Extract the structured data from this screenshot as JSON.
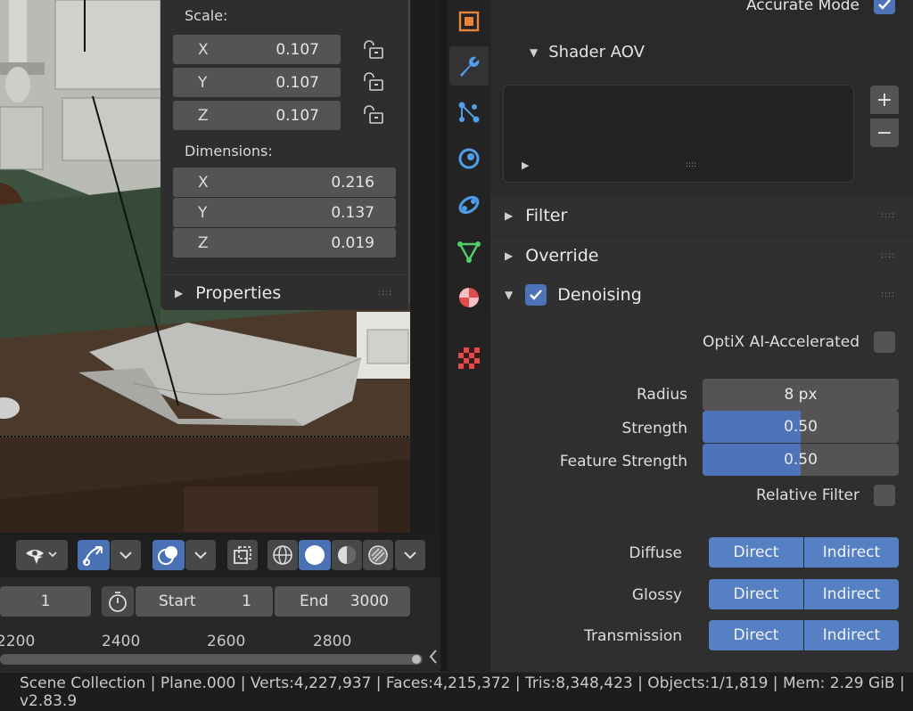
{
  "npanel": {
    "scale_label": "Scale:",
    "scale": [
      {
        "axis": "X",
        "value": "0.107"
      },
      {
        "axis": "Y",
        "value": "0.107"
      },
      {
        "axis": "Z",
        "value": "0.107"
      }
    ],
    "dimensions_label": "Dimensions:",
    "dimensions": [
      {
        "axis": "X",
        "value": "0.216"
      },
      {
        "axis": "Y",
        "value": "0.137"
      },
      {
        "axis": "Z",
        "value": "0.019"
      }
    ],
    "properties_label": "Properties",
    "grip": "::::"
  },
  "timeline": {
    "current_frame": "1",
    "start_label": "Start",
    "start_value": "1",
    "end_label": "End",
    "end_value": "3000",
    "ticks": [
      "2200",
      "2400",
      "2600",
      "2800"
    ]
  },
  "properties": {
    "accurate_mode_label": "Accurate Mode",
    "accurate_mode_checked": true,
    "shader_aov_label": "Shader AOV",
    "aov_list_grip": "::::",
    "add_symbol": "+",
    "remove_symbol": "−",
    "filter_label": "Filter",
    "override_label": "Override",
    "denoising_label": "Denoising",
    "denoising_enabled": true,
    "optix_label": "OptiX AI-Accelerated",
    "optix_checked": false,
    "radius_label": "Radius",
    "radius_value": "8 px",
    "strength_label": "Strength",
    "strength_value": "0.50",
    "strength_fraction": 0.5,
    "feature_strength_label": "Feature Strength",
    "feature_strength_value": "0.50",
    "feature_strength_fraction": 0.5,
    "relative_filter_label": "Relative Filter",
    "relative_filter_checked": false,
    "passes": [
      {
        "label": "Diffuse",
        "direct": "Direct",
        "indirect": "Indirect"
      },
      {
        "label": "Glossy",
        "direct": "Direct",
        "indirect": "Indirect"
      },
      {
        "label": "Transmission",
        "direct": "Direct",
        "indirect": "Indirect"
      }
    ],
    "grip": "::::"
  },
  "status_bar": {
    "text": "Scene Collection | Plane.000 | Verts:4,227,937 | Faces:4,215,372 | Tris:8,348,423 | Objects:1/1,819 | Mem: 2.29 GiB | v2.83.9"
  },
  "colors": {
    "accent": "#4f73b8",
    "panel": "#2e2e2e",
    "field": "#545454"
  }
}
